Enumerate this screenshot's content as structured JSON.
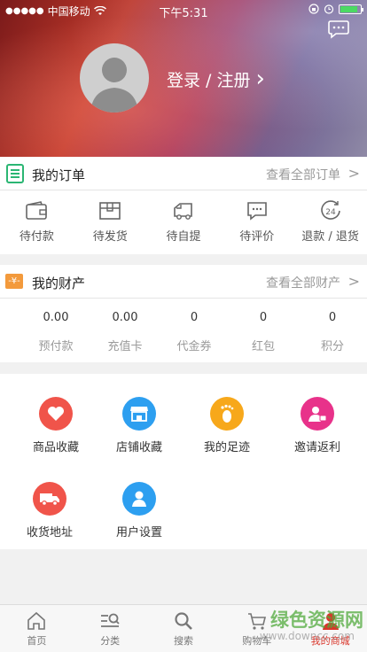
{
  "status_bar": {
    "carrier": "中国移动",
    "time": "下午5:31"
  },
  "profile": {
    "login_label": "登录 / 注册",
    "chevron": "›"
  },
  "orders": {
    "title": "我的订单",
    "more": "查看全部订单",
    "items": [
      {
        "label": "待付款",
        "icon": "wallet-icon"
      },
      {
        "label": "待发货",
        "icon": "box-icon"
      },
      {
        "label": "待自提",
        "icon": "truck-icon"
      },
      {
        "label": "待评价",
        "icon": "comment-icon"
      },
      {
        "label": "退款 / 退货",
        "icon": "refund-24-icon",
        "icon_text": "24"
      }
    ]
  },
  "assets": {
    "title": "我的财产",
    "more": "查看全部财产",
    "badge": "-¥-",
    "items": [
      {
        "value": "0.00",
        "label": "预付款"
      },
      {
        "value": "0.00",
        "label": "充值卡"
      },
      {
        "value": "0",
        "label": "代金券"
      },
      {
        "value": "0",
        "label": "红包"
      },
      {
        "value": "0",
        "label": "积分"
      }
    ]
  },
  "shortcuts": [
    {
      "label": "商品收藏",
      "icon": "heart-icon",
      "color": "#f0544a"
    },
    {
      "label": "店铺收藏",
      "icon": "store-icon",
      "color": "#2d9ff0"
    },
    {
      "label": "我的足迹",
      "icon": "footprint-icon",
      "color": "#f7a81b"
    },
    {
      "label": "邀请返利",
      "icon": "invite-icon",
      "color": "#e8328a"
    },
    {
      "label": "收货地址",
      "icon": "delivery-truck-icon",
      "color": "#f0544a"
    },
    {
      "label": "用户设置",
      "icon": "user-icon",
      "color": "#2d9ff0"
    }
  ],
  "tabbar": [
    {
      "label": "首页",
      "icon": "home-icon"
    },
    {
      "label": "分类",
      "icon": "category-icon"
    },
    {
      "label": "搜索",
      "icon": "search-icon"
    },
    {
      "label": "购物车",
      "icon": "cart-icon"
    },
    {
      "label": "我的商城",
      "icon": "mine-icon",
      "active": true
    }
  ],
  "watermark": {
    "text": "绿色资源网",
    "url": "www.downcc.com"
  },
  "colors": {
    "accent": "#d9362b",
    "orders_icon": "#2bb673",
    "assets_badge": "#f39a3c"
  }
}
